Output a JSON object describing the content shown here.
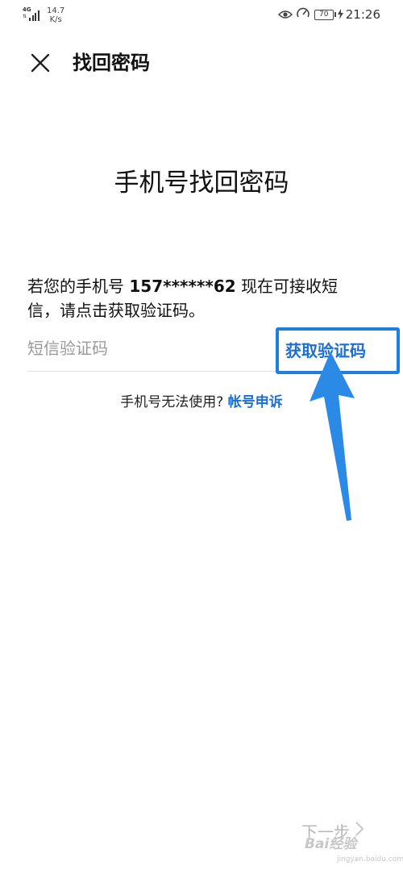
{
  "status_bar": {
    "network_type": "4G",
    "speed_value": "14.7",
    "speed_unit": "K/s",
    "battery_level": "70",
    "time": "21:26"
  },
  "header": {
    "close_icon": "close-icon",
    "title": "找回密码"
  },
  "main": {
    "title": "手机号找回密码",
    "description_prefix": "若您的手机号 ",
    "masked_phone": "157******62",
    "description_suffix": " 现在可接收短信，请点击获取验证码。",
    "sms_code_placeholder": "短信验证码",
    "sms_code_value": "",
    "get_code_label": "获取验证码",
    "help_text": "手机号无法使用? ",
    "appeal_link": "帐号申诉"
  },
  "footer": {
    "next_label": "下一步",
    "next_icon": "chevron-right-icon"
  },
  "watermark": {
    "brand": "Bai经验",
    "domain": "jingyan.baidu.com"
  },
  "colors": {
    "accent": "#1a6fd4",
    "highlight_border": "#1e7fe0",
    "arrow": "#2a8ae6",
    "placeholder": "#9a9a9a",
    "disabled": "#b8b8b8"
  }
}
